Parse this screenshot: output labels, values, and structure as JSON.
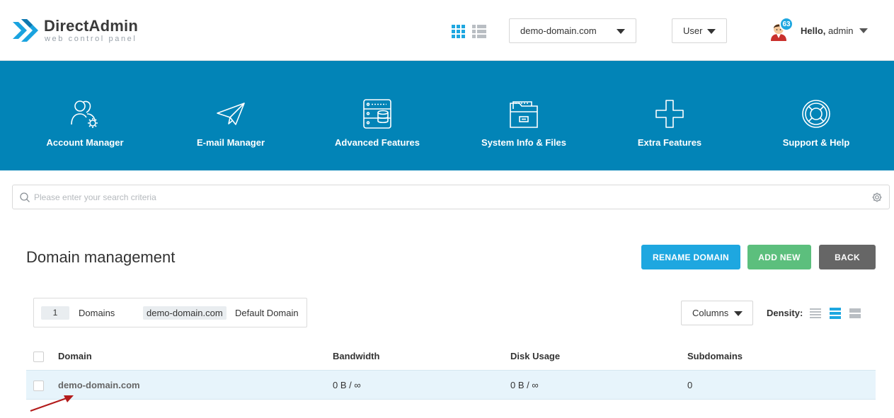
{
  "logo": {
    "title": "DirectAdmin",
    "subtitle": "web control panel"
  },
  "header": {
    "domain_select": "demo-domain.com",
    "role_select": "User",
    "notifications": "63",
    "greeting": "Hello,",
    "username": "admin"
  },
  "nav": [
    {
      "label": "Account Manager",
      "icon": "account-manager-icon"
    },
    {
      "label": "E-mail Manager",
      "icon": "paper-plane-icon"
    },
    {
      "label": "Advanced Features",
      "icon": "server-icon"
    },
    {
      "label": "System Info & Files",
      "icon": "folder-icon"
    },
    {
      "label": "Extra Features",
      "icon": "plus-icon"
    },
    {
      "label": "Support & Help",
      "icon": "lifebuoy-icon"
    }
  ],
  "search": {
    "placeholder": "Please enter your search criteria"
  },
  "page": {
    "title": "Domain management",
    "rename_button": "RENAME DOMAIN",
    "add_button": "ADD NEW",
    "back_button": "BACK"
  },
  "summary": {
    "count": "1",
    "count_label": "Domains",
    "default_domain": "demo-domain.com",
    "default_label": "Default Domain"
  },
  "toolbar": {
    "columns_label": "Columns",
    "density_label": "Density:"
  },
  "table": {
    "headers": [
      "Domain",
      "Bandwidth",
      "Disk Usage",
      "Subdomains"
    ],
    "rows": [
      {
        "domain": "demo-domain.com",
        "bandwidth": "0 B / ∞",
        "disk_usage": "0 B / ∞",
        "subdomains": "0"
      }
    ]
  },
  "colors": {
    "nav_bg": "#0284b7",
    "rename": "#1ea7e0",
    "add": "#5cbf7d",
    "back": "#666666",
    "row_highlight": "#e7f4fb"
  }
}
